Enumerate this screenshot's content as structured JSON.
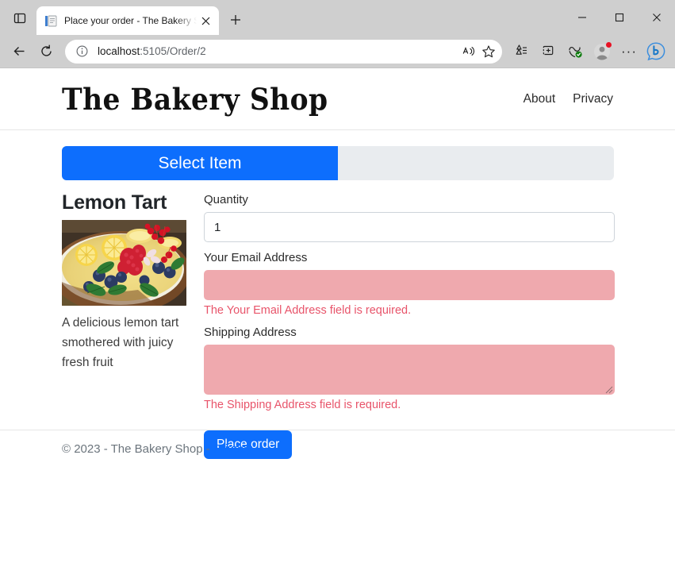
{
  "browser": {
    "tab": {
      "title": "Place your order - The Bakery Sh",
      "favicon_name": "page-favicon",
      "close_label": "✕"
    },
    "new_tab_label": "+",
    "tab_search_name": "tab-search-icon",
    "window_controls": {
      "minimize": "—",
      "maximize": "□",
      "close": "✕"
    },
    "toolbar": {
      "back_label": "←",
      "forward_label": "→",
      "refresh_label": "↻",
      "site_info_label": "ⓘ",
      "url": "localhost:5105/Order/2",
      "url_host": "localhost",
      "url_path": ":5105/Order/2",
      "read_aloud_name": "read-aloud-icon",
      "favorite_name": "favorite-star-icon",
      "collections_name": "collections-icon",
      "split_screen_name": "split-screen-icon",
      "browser_essentials_name": "browser-essentials-icon",
      "profile_name": "profile-avatar-icon",
      "settings_label": "···",
      "copilot_name": "bing-copilot-icon"
    }
  },
  "page": {
    "header": {
      "brand": "The Bakery Shop",
      "nav": [
        {
          "label": "About"
        },
        {
          "label": "Privacy"
        }
      ]
    },
    "steps": {
      "active_label": "Select Item"
    },
    "product": {
      "name": "Lemon Tart",
      "image_alt": "lemon-tart-photo",
      "description": "A delicious lemon tart smothered with juicy fresh fruit"
    },
    "form": {
      "quantity": {
        "label": "Quantity",
        "value": "1",
        "placeholder": ""
      },
      "email": {
        "label": "Your Email Address",
        "value": "",
        "placeholder": "",
        "error": "The Your Email Address field is required."
      },
      "shipping": {
        "label": "Shipping Address",
        "value": "",
        "placeholder": "",
        "error": "The Shipping Address field is required."
      },
      "submit_label": "Place order"
    },
    "footer": {
      "text": "© 2023 - The Bakery Shop - ",
      "link_label": "Privacy"
    }
  },
  "colors": {
    "primary": "#0d6efd",
    "error_text": "#e8546a",
    "error_field_bg": "#efa9ae",
    "step_track": "#e9ecef",
    "chrome": "#cfcfcf"
  }
}
